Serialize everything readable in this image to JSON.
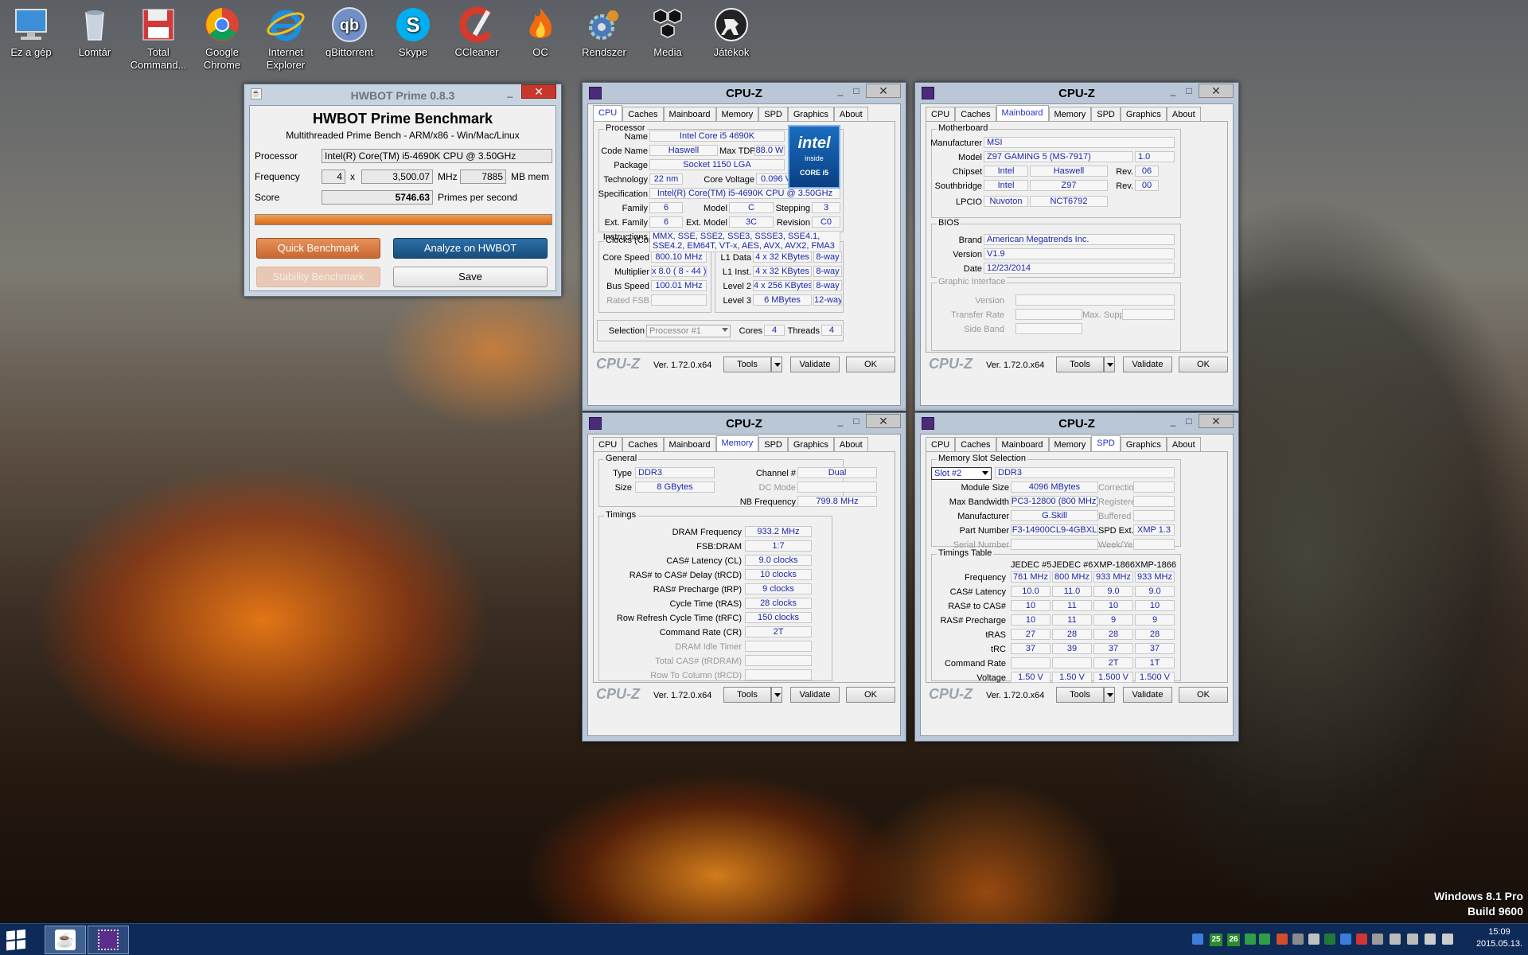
{
  "desktop": {
    "icons": [
      {
        "label": "Ez a gép",
        "icon": "computer-icon"
      },
      {
        "label": "Lomtár",
        "icon": "recycle-bin-icon"
      },
      {
        "label": "Total Command...",
        "icon": "floppy-icon"
      },
      {
        "label": "Google Chrome",
        "icon": "chrome-icon"
      },
      {
        "label": "Internet Explorer",
        "icon": "ie-icon"
      },
      {
        "label": "qBittorrent",
        "icon": "qbittorrent-icon"
      },
      {
        "label": "Skype",
        "icon": "skype-icon"
      },
      {
        "label": "CCleaner",
        "icon": "ccleaner-icon"
      },
      {
        "label": "OC",
        "icon": "flame-icon"
      },
      {
        "label": "Rendszer",
        "icon": "gear-icon"
      },
      {
        "label": "Media",
        "icon": "hexagon-icon"
      },
      {
        "label": "Játékok",
        "icon": "counterstrike-icon"
      }
    ],
    "watermark": {
      "line1": "Windows 8.1 Pro",
      "line2": "Build 9600"
    }
  },
  "hwbot": {
    "title": "HWBOT Prime 0.8.3",
    "heading": "HWBOT Prime Benchmark",
    "subheading": "Multithreaded Prime Bench - ARM/x86 - Win/Mac/Linux",
    "processor_label": "Processor",
    "processor": "Intel(R) Core(TM) i5-4690K CPU @ 3.50GHz",
    "frequency_label": "Frequency",
    "threads": "4",
    "x": "x",
    "freq": "3,500.07",
    "mhz": "MHz",
    "mem": "7885",
    "mbmem": "MB mem",
    "score_label": "Score",
    "score": "5746.63",
    "score_unit": "Primes per second",
    "progress": 1.0,
    "quick": "Quick Benchmark",
    "analyze": "Analyze on HWBOT",
    "stability": "Stability Benchmark",
    "save": "Save"
  },
  "cpuz": {
    "title": "CPU-Z",
    "tabs": [
      "CPU",
      "Caches",
      "Mainboard",
      "Memory",
      "SPD",
      "Graphics",
      "About"
    ],
    "footer": {
      "brand": "CPU-Z",
      "version": "Ver. 1.72.0.x64",
      "tools": "Tools",
      "validate": "Validate",
      "ok": "OK"
    },
    "cpu": {
      "processor_group": "Processor",
      "name_l": "Name",
      "name": "Intel Core i5 4690K",
      "codename_l": "Code Name",
      "codename": "Haswell",
      "maxtdp_l": "Max TDP",
      "maxtdp": "88.0 W",
      "package_l": "Package",
      "package": "Socket 1150 LGA",
      "tech_l": "Technology",
      "tech": "22 nm",
      "voltage_l": "Core Voltage",
      "voltage": "0.096 V",
      "spec_l": "Specification",
      "spec": "Intel(R) Core(TM) i5-4690K CPU @ 3.50GHz",
      "family_l": "Family",
      "family": "6",
      "model_l": "Model",
      "model": "C",
      "stepping_l": "Stepping",
      "stepping": "3",
      "extfamily_l": "Ext. Family",
      "extfamily": "6",
      "extmodel_l": "Ext. Model",
      "extmodel": "3C",
      "revision_l": "Revision",
      "revision": "C0",
      "instr_l": "Instructions",
      "instr": "MMX, SSE, SSE2, SSE3, SSSE3, SSE4.1, SSE4.2, EM64T, VT-x, AES, AVX, AVX2, FMA3",
      "logo": {
        "line1": "intel",
        "line2": "inside",
        "line3": "CORE i5"
      },
      "clocks_group": "Clocks (Core #0)",
      "corespeed_l": "Core Speed",
      "corespeed": "800.10 MHz",
      "mult_l": "Multiplier",
      "mult": "x 8.0 ( 8 - 44 )",
      "bus_l": "Bus Speed",
      "bus": "100.01 MHz",
      "fsb_l": "Rated FSB",
      "cache_group": "Cache",
      "l1d_l": "L1 Data",
      "l1d": "4 x 32 KBytes",
      "l1d_w": "8-way",
      "l1i_l": "L1 Inst.",
      "l1i": "4 x 32 KBytes",
      "l1i_w": "8-way",
      "l2_l": "Level 2",
      "l2": "4 x 256 KBytes",
      "l2_w": "8-way",
      "l3_l": "Level 3",
      "l3": "6 MBytes",
      "l3_w": "12-way",
      "selection_l": "Selection",
      "selection": "Processor #1",
      "cores_l": "Cores",
      "cores": "4",
      "threads_l": "Threads",
      "threads": "4"
    },
    "mb": {
      "mb_group": "Motherboard",
      "manu_l": "Manufacturer",
      "manu": "MSI",
      "model_l": "Model",
      "model": "Z97 GAMING 5 (MS-7917)",
      "model_rev": "1.0",
      "chipset_l": "Chipset",
      "chipset_v": "Intel",
      "chipset": "Haswell",
      "rev_l": "Rev.",
      "chipset_rev": "06",
      "south_l": "Southbridge",
      "south_v": "Intel",
      "south": "Z97",
      "south_rev": "00",
      "lpcio_l": "LPCIO",
      "lpcio_v": "Nuvoton",
      "lpcio": "NCT6792",
      "bios_group": "BIOS",
      "brand_l": "Brand",
      "brand": "American Megatrends Inc.",
      "version_l": "Version",
      "version": "V1.9",
      "date_l": "Date",
      "date": "12/23/2014",
      "gi_group": "Graphic Interface",
      "gi_version_l": "Version",
      "gi_transfer_l": "Transfer Rate",
      "gi_max_l": "Max. Supported",
      "gi_side_l": "Side Band"
    },
    "mem": {
      "general_group": "General",
      "type_l": "Type",
      "type": "DDR3",
      "channel_l": "Channel #",
      "channel": "Dual",
      "size_l": "Size",
      "size": "8 GBytes",
      "dc_l": "DC Mode",
      "nb_l": "NB Frequency",
      "nb": "799.8 MHz",
      "timings_group": "Timings",
      "dram_l": "DRAM Frequency",
      "dram": "933.2 MHz",
      "fsbdram_l": "FSB:DRAM",
      "fsbdram": "1:7",
      "cl_l": "CAS# Latency (CL)",
      "cl": "9.0 clocks",
      "trcd_l": "RAS# to CAS# Delay (tRCD)",
      "trcd": "10 clocks",
      "trp_l": "RAS# Precharge (tRP)",
      "trp": "9 clocks",
      "tras_l": "Cycle Time (tRAS)",
      "tras": "28 clocks",
      "trfc_l": "Row Refresh Cycle Time (tRFC)",
      "trfc": "150 clocks",
      "cr_l": "Command Rate (CR)",
      "cr": "2T",
      "idle_l": "DRAM Idle Timer",
      "trdram_l": "Total CAS# (tRDRAM)",
      "trcd2_l": "Row To Column (tRCD)"
    },
    "spd": {
      "slot_group": "Memory Slot Selection",
      "slot": "Slot #2",
      "slot_type": "DDR3",
      "modsize_l": "Module Size",
      "modsize": "4096 MBytes",
      "correction_l": "Correction",
      "maxbw_l": "Max Bandwidth",
      "maxbw": "PC3-12800 (800 MHz)",
      "registered_l": "Registered",
      "manu_l": "Manufacturer",
      "manu": "G.Skill",
      "buffered_l": "Buffered",
      "part_l": "Part Number",
      "part": "F3-14900CL9-4GBXL",
      "spdext_l": "SPD Ext.",
      "spdext": "XMP 1.3",
      "serial_l": "Serial Number",
      "week_l": "Week/Year",
      "table_group": "Timings Table",
      "cols": [
        "JEDEC #5",
        "JEDEC #6",
        "XMP-1866",
        "XMP-1866"
      ],
      "rows": [
        {
          "label": "Frequency",
          "values": [
            "761 MHz",
            "800 MHz",
            "933 MHz",
            "933 MHz"
          ]
        },
        {
          "label": "CAS# Latency",
          "values": [
            "10.0",
            "11.0",
            "9.0",
            "9.0"
          ]
        },
        {
          "label": "RAS# to CAS#",
          "values": [
            "10",
            "11",
            "10",
            "10"
          ]
        },
        {
          "label": "RAS# Precharge",
          "values": [
            "10",
            "11",
            "9",
            "9"
          ]
        },
        {
          "label": "tRAS",
          "values": [
            "27",
            "28",
            "28",
            "28"
          ]
        },
        {
          "label": "tRC",
          "values": [
            "37",
            "39",
            "37",
            "37"
          ]
        },
        {
          "label": "Command Rate",
          "values": [
            "",
            "",
            "2T",
            "1T"
          ]
        },
        {
          "label": "Voltage",
          "values": [
            "1.50 V",
            "1.50 V",
            "1.500 V",
            "1.500 V"
          ]
        }
      ]
    }
  },
  "taskbar": {
    "time": "15:09",
    "date": "2015.05.13.",
    "tray_nums": [
      "25",
      "26"
    ]
  },
  "colors": {
    "value_text": "#1b27a8",
    "active_tab": "#2432c8",
    "hwbot_orange": "#d9733a",
    "hwbot_blue": "#1e5a8c"
  }
}
